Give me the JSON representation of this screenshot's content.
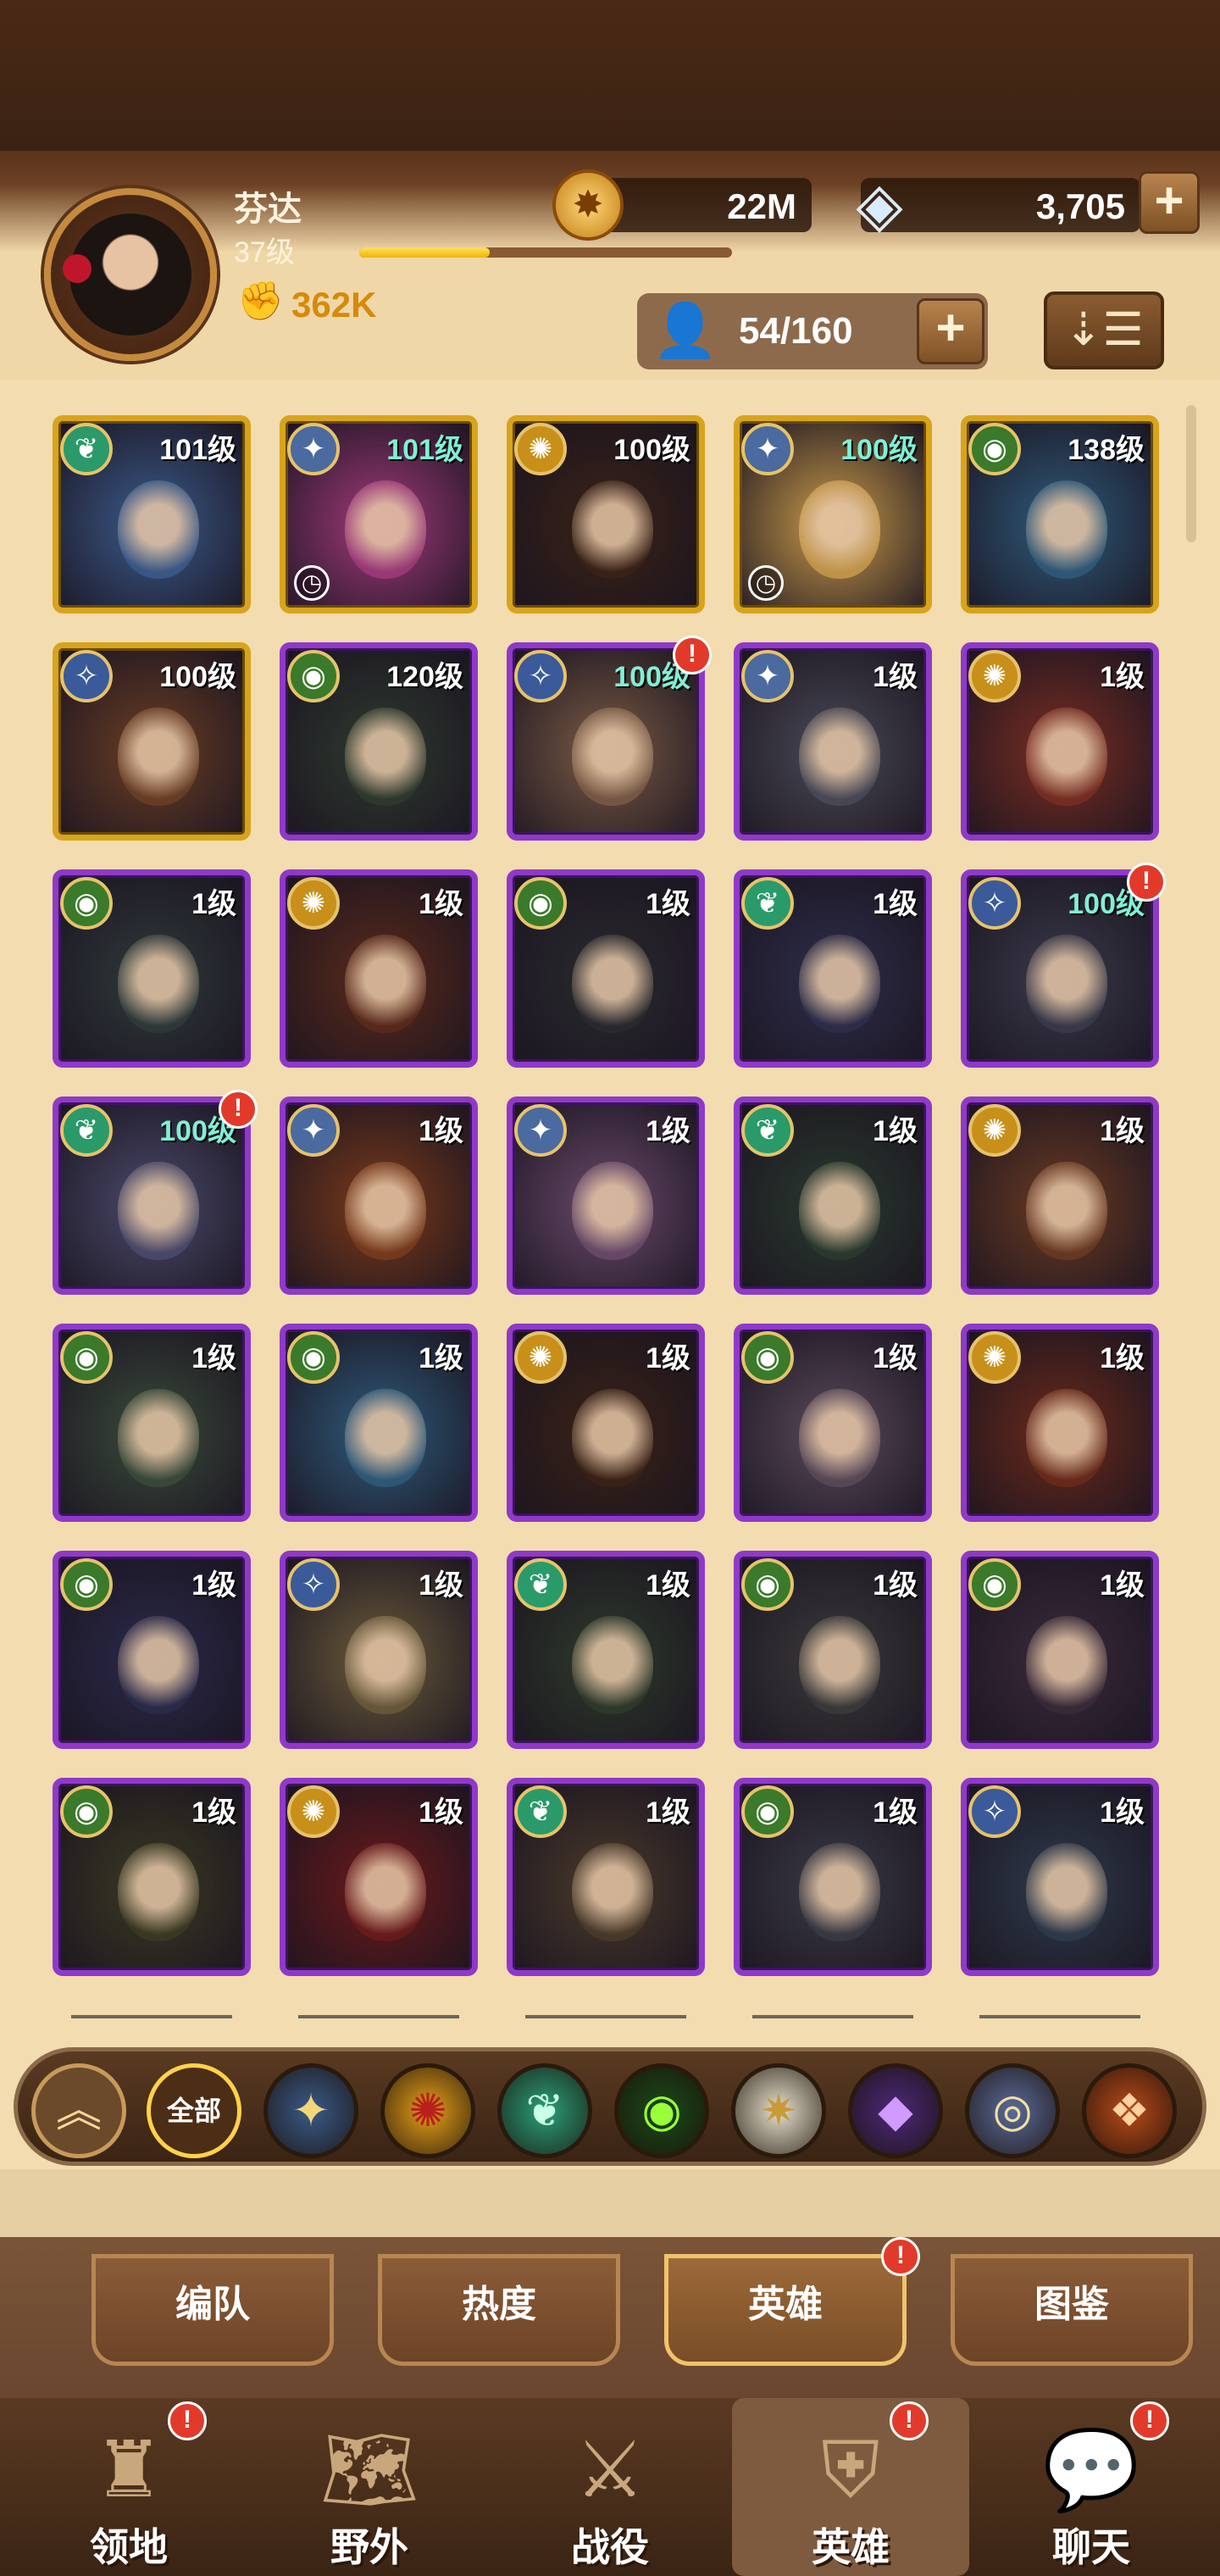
{
  "player": {
    "name": "芬达",
    "level": "37级",
    "xp_fraction": 0.35,
    "power": "362K"
  },
  "currencies": {
    "gold": "22M",
    "diamonds": "3,705"
  },
  "roster": {
    "count": "54/160"
  },
  "heroes": [
    {
      "level": "101级",
      "faction": "wilder",
      "rarity": "gold",
      "level_color": "white",
      "timer": false,
      "alert": false,
      "bg": "#3b5a8a"
    },
    {
      "level": "101级",
      "faction": "celestial",
      "rarity": "gold",
      "level_color": "teal",
      "timer": true,
      "alert": false,
      "bg": "#a03a7a"
    },
    {
      "level": "100级",
      "faction": "graveborn",
      "rarity": "gold",
      "level_color": "white",
      "timer": false,
      "alert": false,
      "bg": "#3a2216"
    },
    {
      "level": "100级",
      "faction": "celestial",
      "rarity": "gold",
      "level_color": "teal",
      "timer": true,
      "alert": false,
      "bg": "#c89a4a"
    },
    {
      "level": "138级",
      "faction": "mauler",
      "rarity": "gold",
      "level_color": "white",
      "timer": false,
      "alert": false,
      "bg": "#2f5a7a"
    },
    {
      "level": "100级",
      "faction": "lightbearer",
      "rarity": "gold",
      "level_color": "white",
      "timer": false,
      "alert": false,
      "bg": "#6a3e24"
    },
    {
      "level": "120级",
      "faction": "mauler",
      "rarity": "purple",
      "level_color": "white",
      "timer": false,
      "alert": false,
      "bg": "#2e3a2e"
    },
    {
      "level": "100级",
      "faction": "lightbearer",
      "rarity": "purple",
      "level_color": "teal",
      "timer": false,
      "alert": true,
      "bg": "#7a5a44"
    },
    {
      "level": "1级",
      "faction": "celestial",
      "rarity": "purple",
      "level_color": "white",
      "timer": false,
      "alert": false,
      "bg": "#4a4a56"
    },
    {
      "level": "1级",
      "faction": "graveborn",
      "rarity": "purple",
      "level_color": "white",
      "timer": false,
      "alert": false,
      "bg": "#7a2e22"
    },
    {
      "level": "1级",
      "faction": "mauler",
      "rarity": "purple",
      "level_color": "white",
      "timer": false,
      "alert": false,
      "bg": "#2e3a3a"
    },
    {
      "level": "1级",
      "faction": "graveborn",
      "rarity": "purple",
      "level_color": "white",
      "timer": false,
      "alert": false,
      "bg": "#5a2a1a"
    },
    {
      "level": "1级",
      "faction": "mauler",
      "rarity": "purple",
      "level_color": "white",
      "timer": false,
      "alert": false,
      "bg": "#2a2a2e"
    },
    {
      "level": "1级",
      "faction": "wilder",
      "rarity": "purple",
      "level_color": "white",
      "timer": false,
      "alert": false,
      "bg": "#2e2e4a"
    },
    {
      "level": "100级",
      "faction": "lightbearer",
      "rarity": "purple",
      "level_color": "teal",
      "timer": false,
      "alert": true,
      "bg": "#3a3a4a"
    },
    {
      "level": "100级",
      "faction": "wilder",
      "rarity": "purple",
      "level_color": "teal",
      "timer": false,
      "alert": true,
      "bg": "#4a4a6a"
    },
    {
      "level": "1级",
      "faction": "celestial",
      "rarity": "purple",
      "level_color": "white",
      "timer": false,
      "alert": false,
      "bg": "#7a3a1a"
    },
    {
      "level": "1级",
      "faction": "celestial",
      "rarity": "purple",
      "level_color": "white",
      "timer": false,
      "alert": false,
      "bg": "#6a4a6a"
    },
    {
      "level": "1级",
      "faction": "wilder",
      "rarity": "purple",
      "level_color": "white",
      "timer": false,
      "alert": false,
      "bg": "#2a3a2e"
    },
    {
      "level": "1级",
      "faction": "graveborn",
      "rarity": "purple",
      "level_color": "white",
      "timer": false,
      "alert": false,
      "bg": "#6a3a22"
    },
    {
      "level": "1级",
      "faction": "mauler",
      "rarity": "purple",
      "level_color": "white",
      "timer": false,
      "alert": false,
      "bg": "#3a4a3a"
    },
    {
      "level": "1级",
      "faction": "mauler",
      "rarity": "purple",
      "level_color": "white",
      "timer": false,
      "alert": false,
      "bg": "#2f5a7a"
    },
    {
      "level": "1级",
      "faction": "graveborn",
      "rarity": "purple",
      "level_color": "white",
      "timer": false,
      "alert": false,
      "bg": "#3a2216"
    },
    {
      "level": "1级",
      "faction": "mauler",
      "rarity": "purple",
      "level_color": "white",
      "timer": false,
      "alert": false,
      "bg": "#5a4a5a"
    },
    {
      "level": "1级",
      "faction": "graveborn",
      "rarity": "purple",
      "level_color": "white",
      "timer": false,
      "alert": false,
      "bg": "#6a2a1a"
    },
    {
      "level": "1级",
      "faction": "mauler",
      "rarity": "purple",
      "level_color": "white",
      "timer": false,
      "alert": false,
      "bg": "#2a2a4a"
    },
    {
      "level": "1级",
      "faction": "lightbearer",
      "rarity": "purple",
      "level_color": "white",
      "timer": false,
      "alert": false,
      "bg": "#6a5a3a"
    },
    {
      "level": "1级",
      "faction": "wilder",
      "rarity": "purple",
      "level_color": "white",
      "timer": false,
      "alert": false,
      "bg": "#2e3a2a"
    },
    {
      "level": "1级",
      "faction": "mauler",
      "rarity": "purple",
      "level_color": "white",
      "timer": false,
      "alert": false,
      "bg": "#3a3a3a"
    },
    {
      "level": "1级",
      "faction": "mauler",
      "rarity": "purple",
      "level_color": "white",
      "timer": false,
      "alert": false,
      "bg": "#3a2a3a"
    },
    {
      "level": "1级",
      "faction": "mauler",
      "rarity": "purple",
      "level_color": "white",
      "timer": false,
      "alert": false,
      "bg": "#3a3a22"
    },
    {
      "level": "1级",
      "faction": "graveborn",
      "rarity": "purple",
      "level_color": "white",
      "timer": false,
      "alert": false,
      "bg": "#6a1a1a"
    },
    {
      "level": "1级",
      "faction": "wilder",
      "rarity": "purple",
      "level_color": "white",
      "timer": false,
      "alert": false,
      "bg": "#4a3a2a"
    },
    {
      "level": "1级",
      "faction": "mauler",
      "rarity": "purple",
      "level_color": "white",
      "timer": false,
      "alert": false,
      "bg": "#3a3a44"
    },
    {
      "level": "1级",
      "faction": "lightbearer",
      "rarity": "purple",
      "level_color": "white",
      "timer": false,
      "alert": false,
      "bg": "#2e3a4a"
    }
  ],
  "faction_colors": {
    "wilder": "#2a9a6a",
    "celestial": "#4a6aa0",
    "graveborn": "#c8901a",
    "mauler": "#3a7a2a",
    "lightbearer": "#3a5a9a"
  },
  "faction_glyphs": {
    "wilder": "❦",
    "celestial": "✦",
    "graveborn": "✺",
    "mauler": "◉",
    "lightbearer": "✧"
  },
  "filters": {
    "collapse_icon": "chevron-up-icon",
    "all_label": "全部",
    "items": [
      {
        "name": "lightbearer-filter-icon",
        "glyph": "✦",
        "bg": "#3a5a8a",
        "fg": "#f4d67a"
      },
      {
        "name": "graveborn-filter-icon",
        "glyph": "✺",
        "bg": "#e6a01a",
        "fg": "#b8201a"
      },
      {
        "name": "wilder-filter-icon",
        "glyph": "❦",
        "bg": "#2aa07a",
        "fg": "#c8ffe6"
      },
      {
        "name": "mauler-filter-icon",
        "glyph": "◉",
        "bg": "#1a4a1a",
        "fg": "#9aff3a"
      },
      {
        "name": "celestial-filter-icon",
        "glyph": "✷",
        "bg": "#e6e0cc",
        "fg": "#c89a3a"
      },
      {
        "name": "hypogean-filter-icon",
        "glyph": "◆",
        "bg": "#4a2a7a",
        "fg": "#d09aff"
      },
      {
        "name": "dimensional-filter-icon",
        "glyph": "◎",
        "bg": "#5a6a9a",
        "fg": "#f0e0a0"
      },
      {
        "name": "draconis-filter-icon",
        "glyph": "❖",
        "bg": "#b84a1a",
        "fg": "#ffd0a0"
      }
    ]
  },
  "tabs": [
    {
      "label": "编队",
      "active": false,
      "alert": false
    },
    {
      "label": "热度",
      "active": false,
      "alert": false
    },
    {
      "label": "英雄",
      "active": true,
      "alert": true
    },
    {
      "label": "图鉴",
      "active": false,
      "alert": false
    }
  ],
  "nav": [
    {
      "label": "领地",
      "icon": "castle-icon",
      "glyph": "♜",
      "active": false,
      "alert": true
    },
    {
      "label": "野外",
      "icon": "scroll-map-icon",
      "glyph": "🗺",
      "active": false,
      "alert": false
    },
    {
      "label": "战役",
      "icon": "sword-shield-icon",
      "glyph": "⚔",
      "active": false,
      "alert": false
    },
    {
      "label": "英雄",
      "icon": "helmet-icon",
      "glyph": "⛨",
      "active": true,
      "alert": true
    },
    {
      "label": "聊天",
      "icon": "chat-bubble-icon",
      "glyph": "💬",
      "active": false,
      "alert": true
    }
  ],
  "misc": {
    "alert_glyph": "!",
    "plus_glyph": "+",
    "sort_glyph": "⇣☰",
    "timer_glyph": "◷",
    "power_glyph": "✊",
    "roster_glyph": "👤",
    "coin_glyph": "✸",
    "gem_glyph": "◈"
  }
}
